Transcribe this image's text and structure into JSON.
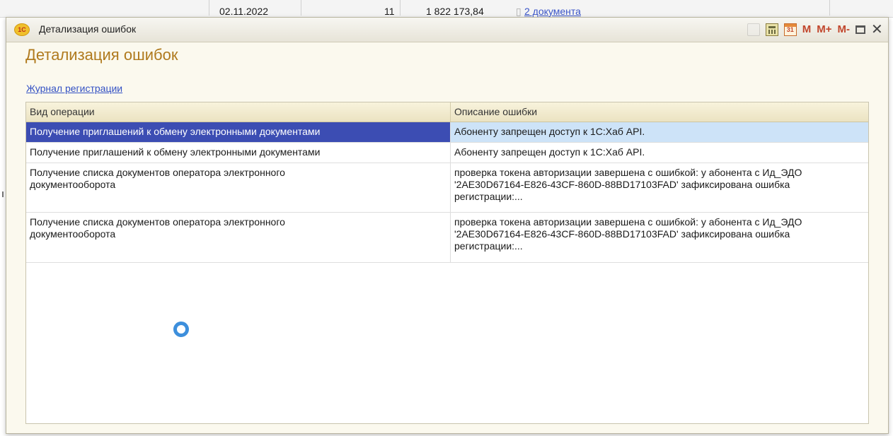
{
  "background_window": {
    "date": "02.11.2022",
    "count": "11",
    "amount": "1 822 173,84",
    "documents_link": "2 документа"
  },
  "window": {
    "title": "Детализация ошибок",
    "logo_text": "1С",
    "toolbar": {
      "calendar_label": "31",
      "m_label": "M",
      "m_plus_label": "M+",
      "m_minus_label": "M-",
      "close_label": "✕"
    }
  },
  "form": {
    "heading": "Детализация ошибок",
    "journal_link": "Журнал регистрации"
  },
  "table": {
    "columns": [
      "Вид операции",
      "Описание ошибки"
    ],
    "rows": [
      {
        "operation": "Получение приглашений к обмену электронными документами",
        "description": "Абоненту запрещен доступ к 1С:Хаб API."
      },
      {
        "operation": "Получение приглашений к обмену электронными документами",
        "description": "Абоненту запрещен доступ к 1С:Хаб API."
      },
      {
        "operation": "Получение списка документов оператора электронного документооборота",
        "description": "проверка токена авторизации завершена с ошибкой: у абонента с Ид_ЭДО '2AE30D67164-E826-43CF-860D-88BD17103FAD' зафиксирована ошибка регистрации:..."
      },
      {
        "operation": "Получение списка документов оператора электронного документооборота",
        "description": "проверка токена авторизации завершена с ошибкой: у абонента с Ид_ЭДО '2AE30D67164-E826-43CF-860D-88BD17103FAD' зафиксирована ошибка регистрации:..."
      }
    ]
  },
  "colors": {
    "heading": "#b07a1e",
    "selected_row": "#3c4db3",
    "selected_row_secondary": "#cde3f8",
    "link": "#3351c4",
    "spinner": "#3d8fdc"
  }
}
